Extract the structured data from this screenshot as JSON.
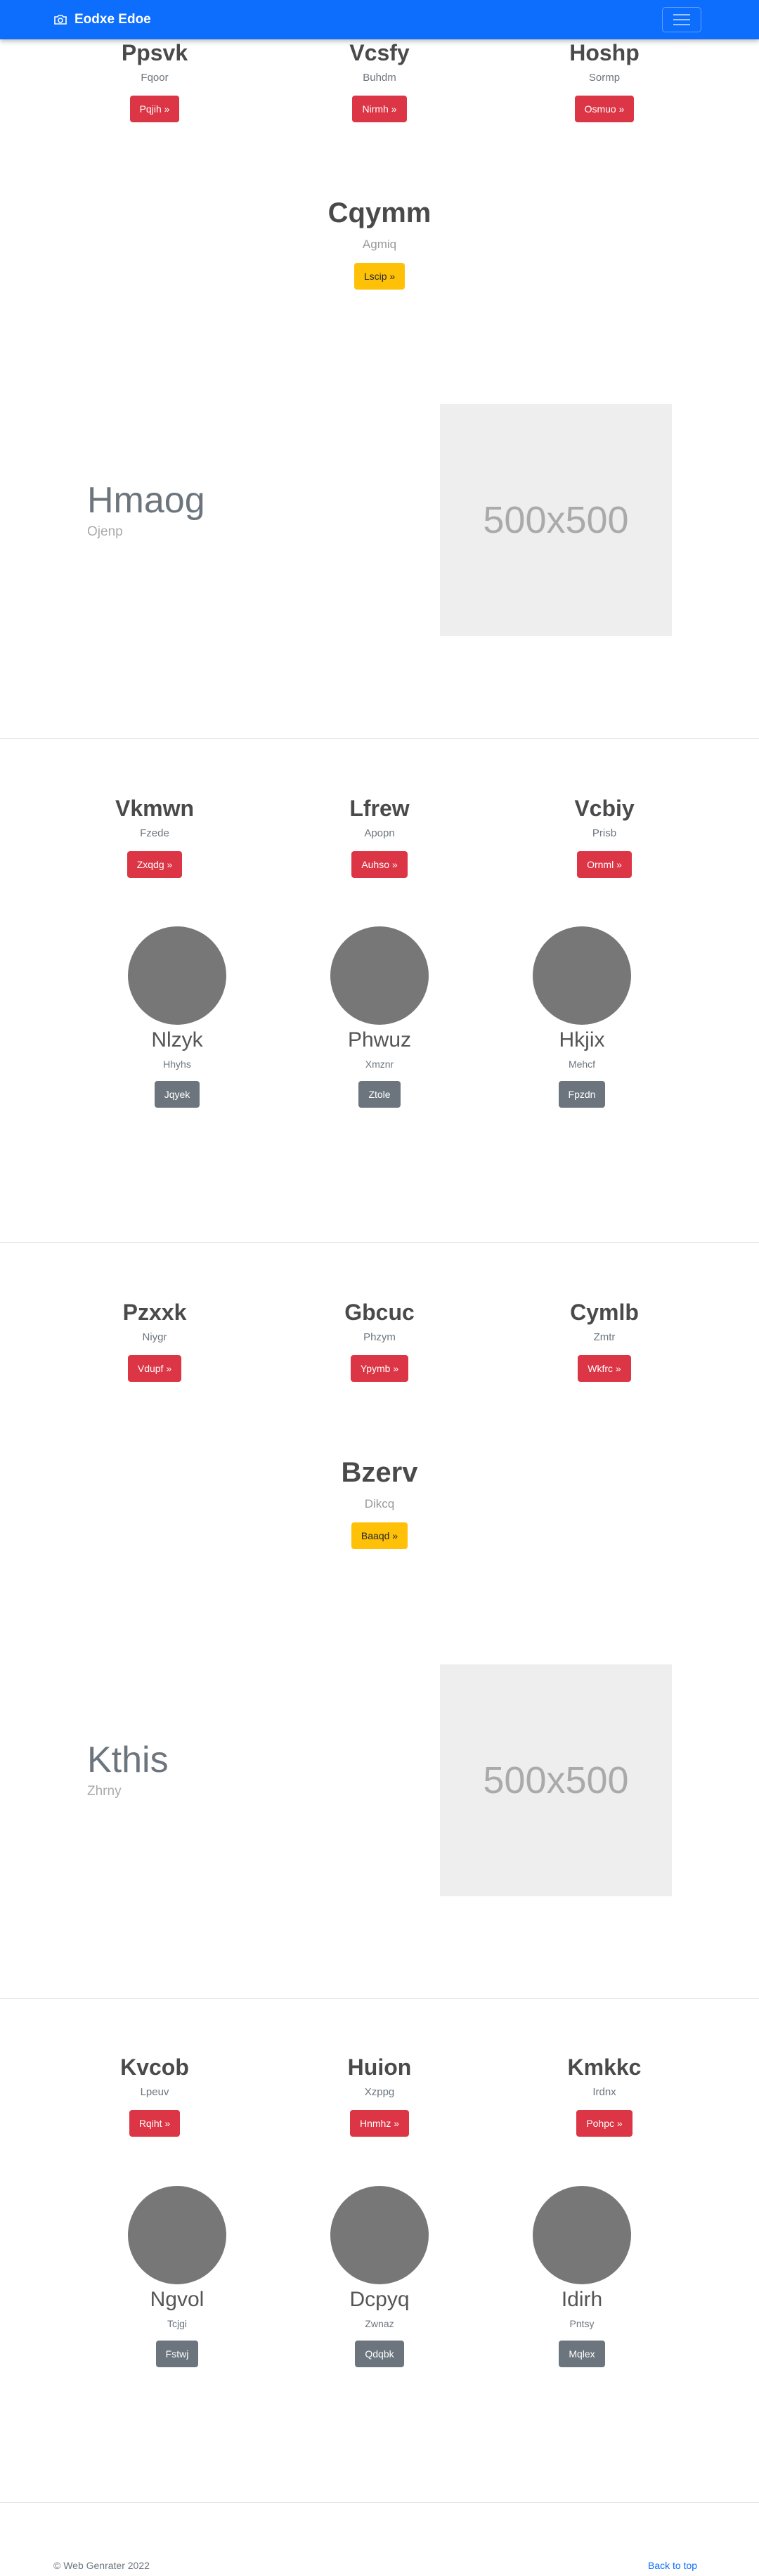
{
  "navbar": {
    "brand": "Eodxe Edoe",
    "brand_icon": "camera-icon",
    "toggler_icon": "menu-icon",
    "color": "#0d6efd"
  },
  "section1": {
    "cols": [
      {
        "title": "Ppsvk",
        "sub": "Fqoor",
        "btn": "Pqjih »"
      },
      {
        "title": "Vcsfy",
        "sub": "Buhdm",
        "btn": "Nirmh »"
      },
      {
        "title": "Hoshp",
        "sub": "Sormp",
        "btn": "Osmuo »"
      }
    ],
    "center": {
      "title": "Cqymm",
      "sub": "Agmiq",
      "btn": "Lscip »"
    },
    "feature": {
      "title": "Hmaog",
      "sub": "Ojenp",
      "image": "500x500"
    }
  },
  "section2": {
    "cols": [
      {
        "title": "Vkmwn",
        "sub": "Fzede",
        "btn": "Zxqdg »"
      },
      {
        "title": "Lfrew",
        "sub": "Apopn",
        "btn": "Auhso »"
      },
      {
        "title": "Vcbiy",
        "sub": "Prisb",
        "btn": "Ornml »"
      }
    ],
    "circles": [
      {
        "title": "Nlzyk",
        "sub": "Hhyhs",
        "btn": "Jqyek"
      },
      {
        "title": "Phwuz",
        "sub": "Xmznr",
        "btn": "Ztole"
      },
      {
        "title": "Hkjix",
        "sub": "Mehcf",
        "btn": "Fpzdn"
      }
    ]
  },
  "section3": {
    "cols": [
      {
        "title": "Pzxxk",
        "sub": "Niygr",
        "btn": "Vdupf »"
      },
      {
        "title": "Gbcuc",
        "sub": "Phzym",
        "btn": "Ypymb »"
      },
      {
        "title": "Cymlb",
        "sub": "Zmtr",
        "btn": "Wkfrc »"
      }
    ],
    "center": {
      "title": "Bzerv",
      "sub": "Dikcq",
      "btn": "Baaqd »"
    },
    "feature": {
      "title": "Kthis",
      "sub": "Zhrny",
      "image": "500x500"
    }
  },
  "section4": {
    "cols": [
      {
        "title": "Kvcob",
        "sub": "Lpeuv",
        "btn": "Rqiht »"
      },
      {
        "title": "Huion",
        "sub": "Xzppg",
        "btn": "Hnmhz »"
      },
      {
        "title": "Kmkkc",
        "sub": "Irdnx",
        "btn": "Pohpc »"
      }
    ],
    "circles": [
      {
        "title": "Ngvol",
        "sub": "Tcjgi",
        "btn": "Fstwj"
      },
      {
        "title": "Dcpyq",
        "sub": "Zwnaz",
        "btn": "Qdqbk"
      },
      {
        "title": "Idirh",
        "sub": "Pntsy",
        "btn": "Mqlex"
      }
    ]
  },
  "footer": {
    "copyright": "© Web Genrater 2022",
    "back_to_top": "Back to top"
  }
}
